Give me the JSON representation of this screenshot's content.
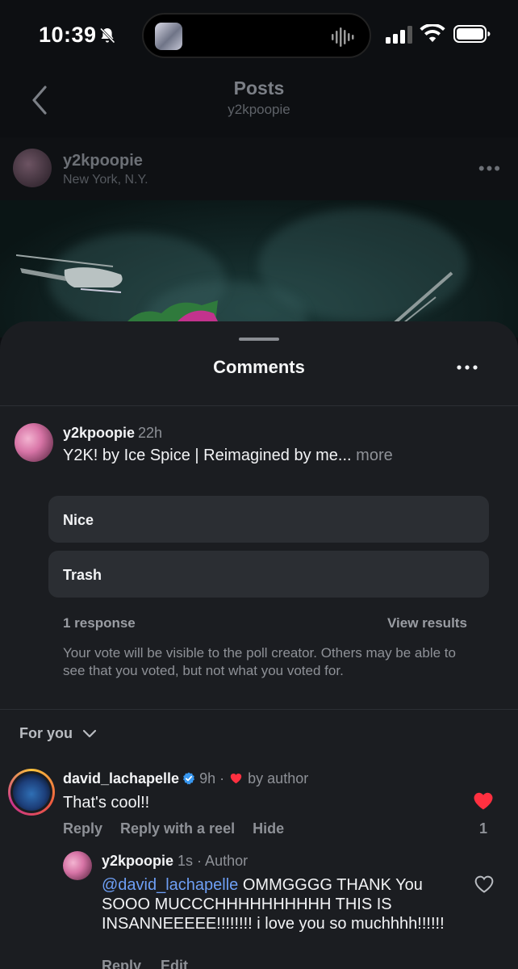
{
  "status_bar": {
    "time": "10:39"
  },
  "header": {
    "title": "Posts",
    "subtitle": "y2kpoopie"
  },
  "post": {
    "username": "y2kpoopie",
    "location": "New York, N.Y."
  },
  "sheet": {
    "title": "Comments",
    "caption": {
      "username": "y2kpoopie",
      "time": "22h",
      "text": "Y2K! by Ice Spice | Reimagined by me...",
      "more": "more"
    },
    "poll": {
      "options": [
        "Nice",
        "Trash"
      ],
      "responses": "1 response",
      "view_results": "View results",
      "note": "Your vote will be visible to the poll creator. Others may be able to see that you voted, but not what you voted for."
    },
    "filter": {
      "label": "For you"
    },
    "comments": [
      {
        "username": "david_lachapelle",
        "time": "9h ·",
        "liked_by": "by author",
        "text": "That's cool!!",
        "actions": [
          "Reply",
          "Reply with a reel",
          "Hide"
        ],
        "likes": "1"
      },
      {
        "username": "y2kpoopie",
        "time": "1s · Author",
        "mention": "@david_lachapelle",
        "text": "OMMGGGG THANK You SOOO MUCCCHHHHHHHHHH THIS IS INSANNEEEEE!!!!!!!! i love you so muchhhh!!!!!!",
        "actions": [
          "Reply",
          "Edit"
        ]
      }
    ]
  },
  "colors": {
    "accent_red": "#ff3040",
    "mention_blue": "#6e9ff5",
    "verified_blue": "#3897f0"
  },
  "icons": [
    "bell-slash-icon",
    "signal-icon",
    "wifi-icon",
    "battery-icon",
    "back-chevron-icon",
    "more-icon",
    "chevron-down-icon",
    "heart-icon",
    "verified-badge-icon"
  ]
}
